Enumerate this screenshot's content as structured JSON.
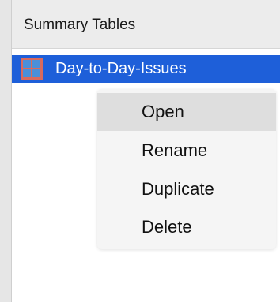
{
  "panel": {
    "title": "Summary Tables"
  },
  "list": {
    "items": [
      {
        "label": "Day-to-Day-Issues",
        "icon": "table-grid-icon",
        "selected": true
      }
    ]
  },
  "context_menu": {
    "items": [
      {
        "label": "Open",
        "highlighted": true
      },
      {
        "label": "Rename"
      },
      {
        "label": "Duplicate"
      },
      {
        "label": "Delete"
      }
    ]
  },
  "colors": {
    "selection": "#1e5fd9",
    "icon_fill": "#4a90d9",
    "icon_border": "#d96a5e",
    "menu_highlight": "#dedede"
  }
}
